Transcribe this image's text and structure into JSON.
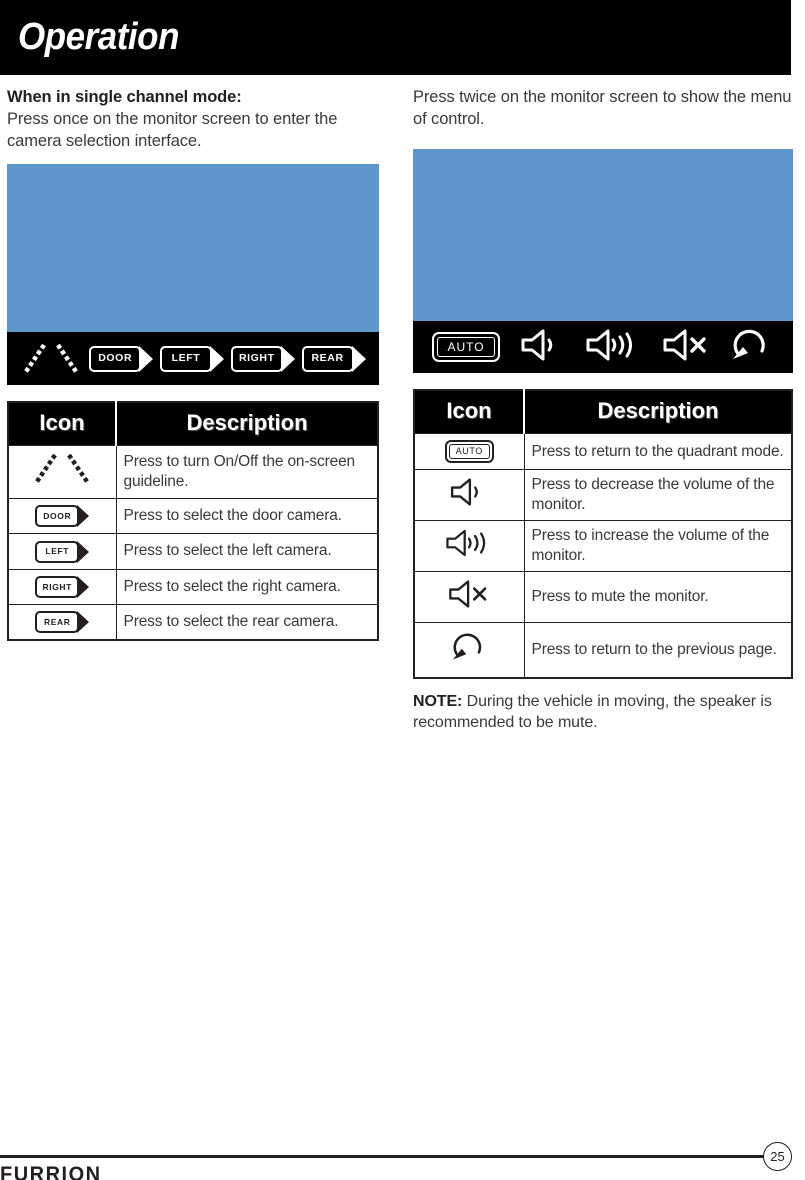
{
  "header": {
    "title": "Operation"
  },
  "left": {
    "lead_bold": "When in single channel mode:",
    "lead_text": "Press once on the monitor screen to enter the camera selection interface.",
    "screenshot_icons": [
      {
        "name": "guideline-icon",
        "type": "guideline",
        "label": ""
      },
      {
        "name": "door-camera-icon",
        "type": "camera",
        "label": "DOOR"
      },
      {
        "name": "left-camera-icon",
        "type": "camera",
        "label": "LEFT"
      },
      {
        "name": "right-camera-icon",
        "type": "camera",
        "label": "RIGHT"
      },
      {
        "name": "rear-camera-icon",
        "type": "camera",
        "label": "REAR"
      }
    ],
    "table": {
      "headers": [
        "Icon",
        "Description"
      ],
      "rows": [
        {
          "icon": "guideline-icon",
          "type": "guideline",
          "label": "",
          "desc": "Press to turn On/Off the on-screen guideline."
        },
        {
          "icon": "door-camera-icon",
          "type": "camera",
          "label": "DOOR",
          "desc": "Press to select the door camera."
        },
        {
          "icon": "left-camera-icon",
          "type": "camera",
          "label": "LEFT",
          "desc": "Press to select the left camera."
        },
        {
          "icon": "right-camera-icon",
          "type": "camera",
          "label": "RIGHT",
          "desc": "Press to select the right camera."
        },
        {
          "icon": "rear-camera-icon",
          "type": "camera",
          "label": "REAR",
          "desc": "Press to select the rear camera."
        }
      ]
    }
  },
  "right": {
    "lead_text": "Press twice on the monitor screen to show the menu of control.",
    "screenshot_icons": [
      {
        "name": "auto-button-icon",
        "type": "auto",
        "label": "AUTO"
      },
      {
        "name": "volume-down-icon",
        "type": "volume-down",
        "label": ""
      },
      {
        "name": "volume-up-icon",
        "type": "volume-up",
        "label": ""
      },
      {
        "name": "mute-icon",
        "type": "mute",
        "label": ""
      },
      {
        "name": "return-icon",
        "type": "return",
        "label": ""
      }
    ],
    "table": {
      "headers": [
        "Icon",
        "Description"
      ],
      "rows": [
        {
          "icon": "auto-button-icon",
          "type": "auto",
          "label": "AUTO",
          "desc": "Press to return to the quadrant mode."
        },
        {
          "icon": "volume-down-icon",
          "type": "volume-down",
          "label": "",
          "desc": "Press to decrease the volume of the monitor."
        },
        {
          "icon": "volume-up-icon",
          "type": "volume-up",
          "label": "",
          "desc": "Press to increase the volume of the monitor."
        },
        {
          "icon": "mute-icon",
          "type": "mute",
          "label": "",
          "desc": "Press to mute the monitor."
        },
        {
          "icon": "return-icon",
          "type": "return",
          "label": "",
          "desc": "Press to return to the previous page."
        }
      ]
    },
    "note_label": "NOTE:",
    "note_text": "During the vehicle in moving, the speaker is recommended to be mute."
  },
  "footer": {
    "page_number": "25",
    "brand": "FURRION"
  },
  "colors": {
    "screen_blue": "#5e95cb",
    "bar_black": "#000000",
    "ink": "#231f20"
  }
}
